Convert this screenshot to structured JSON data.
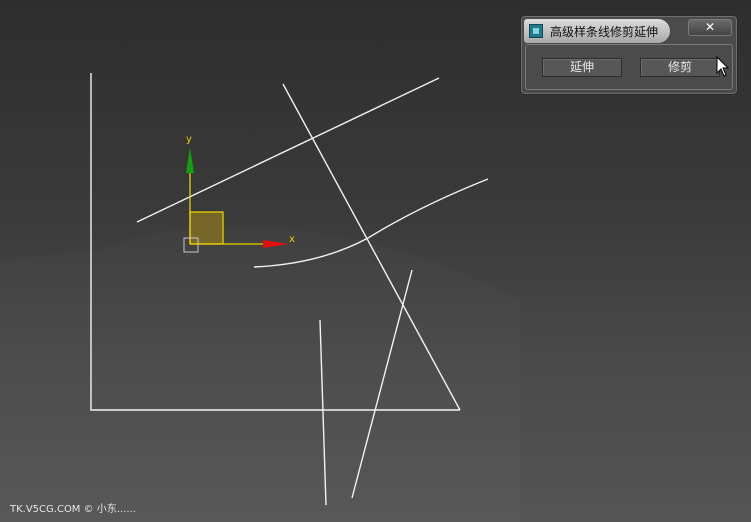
{
  "dialog": {
    "title": "高级样条线修剪延伸",
    "close_glyph": "✕",
    "extend_label": "延伸",
    "trim_label": "修剪"
  },
  "gizmo": {
    "x_label": "x",
    "y_label": "y",
    "x_color": "#e01010",
    "y_color": "#10a010",
    "plane_color": "#8a7420"
  },
  "watermark": "TK.V5CG.COM © 小东......"
}
